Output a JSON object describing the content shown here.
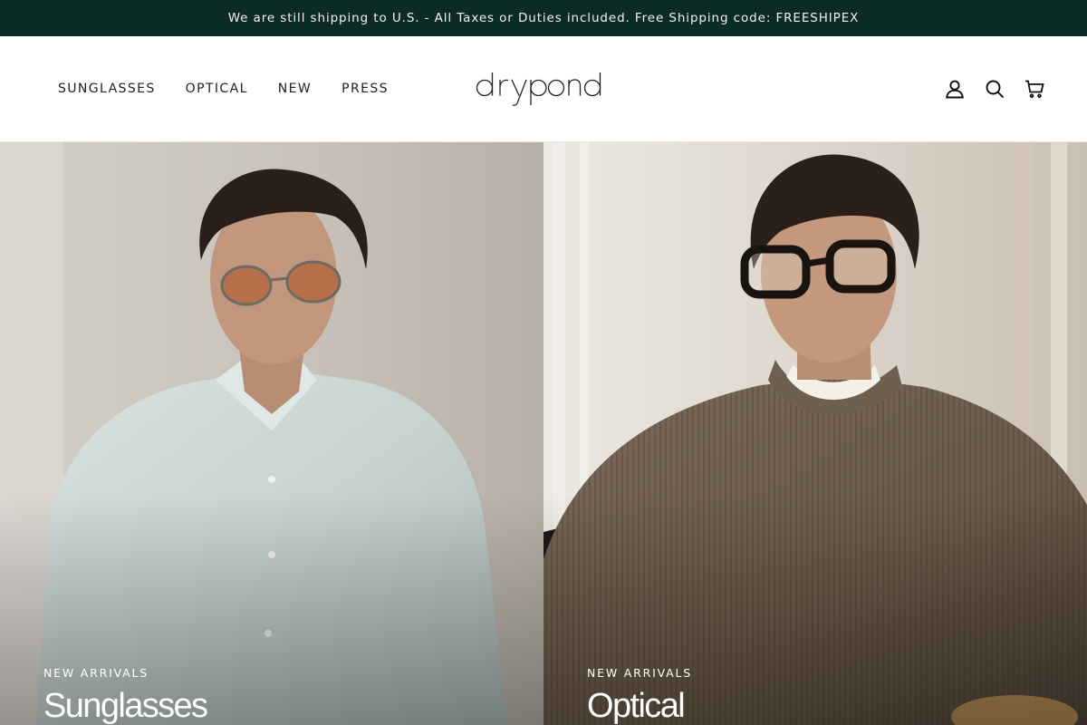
{
  "announcement": {
    "text": "We are still shipping to U.S. - All Taxes or Duties included. Free Shipping code: FREESHIPEX"
  },
  "header": {
    "nav": [
      {
        "label": "SUNGLASSES"
      },
      {
        "label": "OPTICAL"
      },
      {
        "label": "NEW"
      },
      {
        "label": "PRESS"
      }
    ],
    "logo_text": "drypond",
    "icons": [
      "account-icon",
      "search-icon",
      "cart-icon"
    ]
  },
  "hero": [
    {
      "eyebrow": "NEW ARRIVALS",
      "title": "Sunglasses",
      "image": "man in light blue shirt wearing tinted round sunglasses"
    },
    {
      "eyebrow": "NEW ARRIVALS",
      "title": "Optical",
      "image": "man in brown ribbed knit sweater wearing black optical frames"
    }
  ],
  "colors": {
    "announcement_bg": "#0c2a26",
    "announcement_text": "#f2f2f2",
    "hero_text": "#ffffff"
  }
}
